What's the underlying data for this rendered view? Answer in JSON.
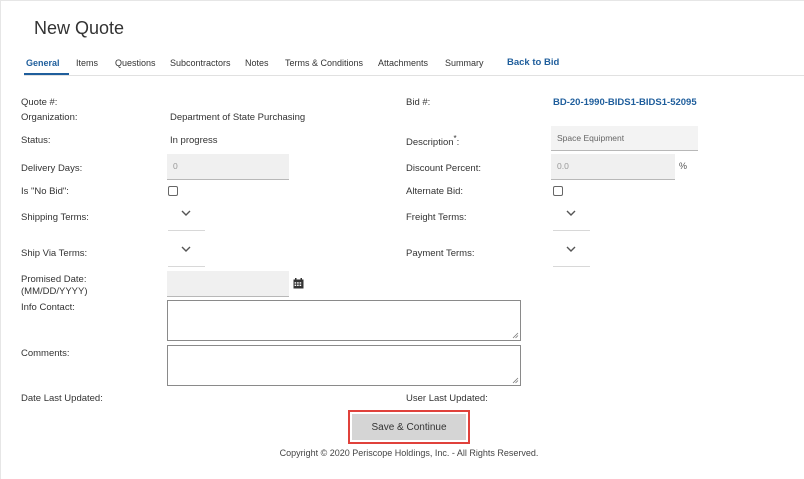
{
  "page": {
    "title": "New Quote"
  },
  "tabs": [
    {
      "label": "General",
      "active": true
    },
    {
      "label": "Items"
    },
    {
      "label": "Questions"
    },
    {
      "label": "Subcontractors"
    },
    {
      "label": "Notes"
    },
    {
      "label": "Terms & Conditions"
    },
    {
      "label": "Attachments"
    },
    {
      "label": "Summary"
    },
    {
      "label": "Back to Bid"
    }
  ],
  "form": {
    "quote_label": "Quote #:",
    "organization_label": "Organization:",
    "organization_value": "Department of State Purchasing",
    "status_label": "Status:",
    "status_value": "In progress",
    "delivery_days_label": "Delivery Days:",
    "delivery_days_value": "0",
    "no_bid_label": "Is \"No Bid\":",
    "shipping_terms_label": "Shipping Terms:",
    "ship_via_label": "Ship Via Terms:",
    "promised_date_label": "Promised Date:",
    "promised_date_format": "(MM/DD/YYYY)",
    "info_contact_label": "Info Contact:",
    "comments_label": "Comments:",
    "date_last_updated_label": "Date Last Updated:",
    "bid_label": "Bid #:",
    "bid_value": "BD-20-1990-BIDS1-BIDS1-52095",
    "description_label": "Description",
    "description_required": "*",
    "description_colon": ":",
    "description_value": "Space Equipment",
    "discount_label": "Discount Percent:",
    "discount_value": "0.0",
    "discount_unit": "%",
    "alternate_bid_label": "Alternate Bid:",
    "freight_terms_label": "Freight Terms:",
    "payment_terms_label": "Payment Terms:",
    "user_last_updated_label": "User Last Updated:"
  },
  "actions": {
    "save_label": "Save & Continue"
  },
  "footer": {
    "copyright": "Copyright © 2020 Periscope Holdings, Inc. - All Rights Reserved."
  },
  "colors": {
    "accent": "#1f5e9c",
    "highlight": "#e0413b",
    "button": "#d5d5d5"
  },
  "icons": [
    "chevron-down-icon",
    "calendar-icon",
    "resize-grip-icon"
  ]
}
